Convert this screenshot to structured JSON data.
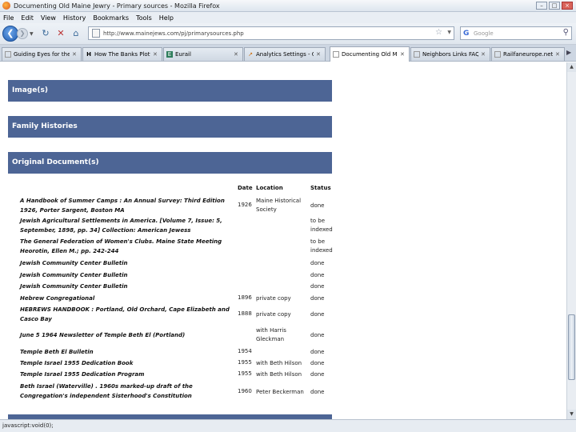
{
  "window": {
    "title": "Documenting Old Maine Jewry - Primary sources - Mozilla Firefox",
    "controls": [
      "–",
      "□",
      "×"
    ]
  },
  "menu": [
    "File",
    "Edit",
    "View",
    "History",
    "Bookmarks",
    "Tools",
    "Help"
  ],
  "nav": {
    "url": "http://www.mainejews.com/pj/primarysources.php",
    "search_placeholder": "Google"
  },
  "tabs": [
    {
      "label": "Guiding Eyes for the B...",
      "icon": "page-icon"
    },
    {
      "label": "How The Banks Plotte...",
      "icon": "h-icon"
    },
    {
      "label": "Eurail",
      "icon": "eurail-icon"
    },
    {
      "label": "Analytics Settings - G...",
      "icon": "analytics-icon"
    },
    {
      "label": "Documenting Old M...",
      "icon": "page-icon",
      "active": true
    },
    {
      "label": "Neighbors Links FAQ",
      "icon": "page-icon"
    },
    {
      "label": "Railfaneurope.net, Th...",
      "icon": "page-icon"
    }
  ],
  "sections": {
    "images": "Image(s)",
    "family": "Family Histories",
    "original": "Original Document(s)"
  },
  "table": {
    "headers": {
      "date": "Date",
      "location": "Location",
      "status": "Status"
    },
    "rows": [
      {
        "title": "A Handbook of Summer Camps : An Annual Survey: Third Edition 1926, Porter Sargent, Boston MA",
        "date": "1926",
        "location": "Maine Historical Society",
        "status": "done"
      },
      {
        "title": "Jewish Agricultural Settlements in America. [Volume 7, Issue: 5, September, 1898, pp. 34] Collection: American Jewess",
        "date": "",
        "location": "",
        "status": "to be indexed"
      },
      {
        "title": "The General Federation of Women's Clubs. Maine State Meeting Heorotin, Ellen M.; pp. 242-244",
        "date": "",
        "location": "",
        "status": "to be indexed"
      },
      {
        "title": "Jewish Community Center Bulletin",
        "date": "",
        "location": "",
        "status": "done"
      },
      {
        "title": "Jewish Community Center Bulletin",
        "date": "",
        "location": "",
        "status": "done"
      },
      {
        "title": "Jewish Community Center Bulletin",
        "date": "",
        "location": "",
        "status": "done"
      },
      {
        "title": "Hebrew Congregational",
        "date": "1896",
        "location": "private copy",
        "status": "done"
      },
      {
        "title": "HEBREWS HANDBOOK : Portland, Old Orchard, Cape Elizabeth and Casco Bay",
        "date": "1888",
        "location": "private copy",
        "status": "done"
      },
      {
        "title": "June 5 1964 Newsletter of Temple Beth El (Portland)",
        "date": "",
        "location": "with Harris Gleckman",
        "status": "done"
      },
      {
        "title": "Temple Beth El Bulletin",
        "date": "1954",
        "location": "",
        "status": "done"
      },
      {
        "title": "Temple Israel 1955 Dedication Book",
        "date": "1955",
        "location": "with Beth Hilson",
        "status": "done"
      },
      {
        "title": "Temple Israel 1955 Dedication Program",
        "date": "1955",
        "location": "with Beth Hilson",
        "status": "done"
      },
      {
        "title": "Beth Israel (Waterville) . 1960s marked-up draft of the Congregation's independent Sisterhood's Constitution",
        "date": "1960",
        "location": "Peter Beckerman",
        "status": "done"
      }
    ]
  },
  "status_bar": "javascript:void(0);",
  "colors": {
    "section_bar": "#4d6595"
  }
}
